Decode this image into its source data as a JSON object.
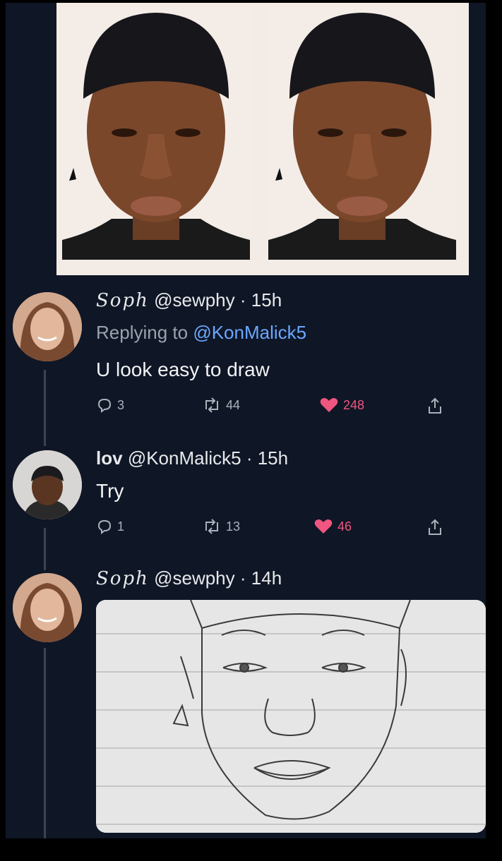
{
  "tweets": [
    {
      "display_name": "Soph",
      "handle": "@sewphy",
      "time": "· 15h",
      "replying_prefix": "Replying to",
      "replying_to": "@KonMalick5",
      "text": "U look easy to draw",
      "replies": "3",
      "retweets": "44",
      "likes": "248"
    },
    {
      "display_name": "lov",
      "handle": "@KonMalick5",
      "time": "· 15h",
      "text": "Try",
      "replies": "1",
      "retweets": "13",
      "likes": "46"
    },
    {
      "display_name": "Soph",
      "handle": "@sewphy",
      "time": "· 14h"
    }
  ],
  "colors": {
    "background": "#0f1626",
    "like": "#f0567f",
    "mention": "#6aa8ff"
  },
  "icons": [
    "reply-icon",
    "retweet-icon",
    "heart-icon",
    "share-icon"
  ]
}
